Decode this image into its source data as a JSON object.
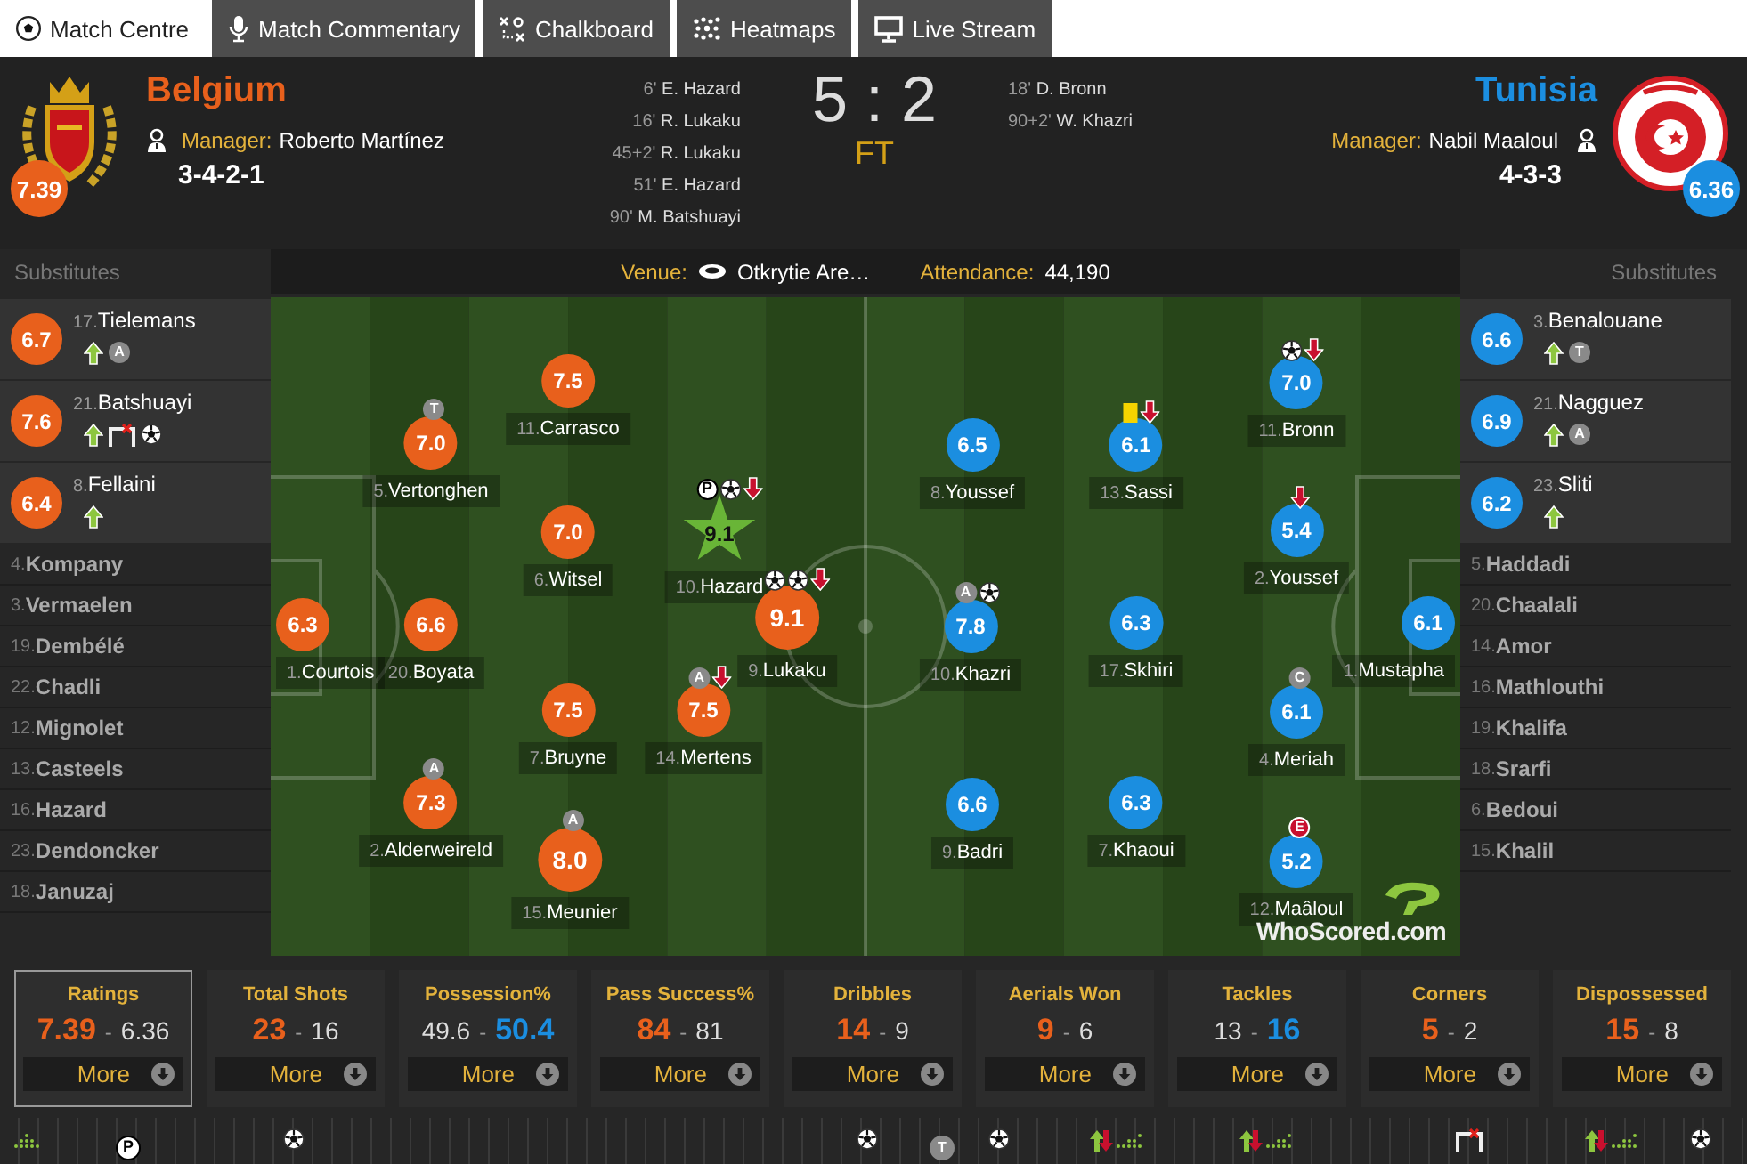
{
  "tabs": [
    {
      "label": "Match Centre",
      "selected": true
    },
    {
      "label": "Match Commentary",
      "selected": false
    },
    {
      "label": "Chalkboard",
      "selected": false
    },
    {
      "label": "Heatmaps",
      "selected": false
    },
    {
      "label": "Live Stream",
      "selected": false
    }
  ],
  "score": {
    "home": "5",
    "separator": ":",
    "away": "2",
    "status": "FT"
  },
  "home": {
    "name": "Belgium",
    "rating": "7.39",
    "manager_label": "Manager:",
    "manager": "Roberto Martínez",
    "formation": "3-4-2-1",
    "goals": [
      {
        "minute": "6'",
        "player": "E. Hazard"
      },
      {
        "minute": "16'",
        "player": "R. Lukaku"
      },
      {
        "minute": "45+2'",
        "player": "R. Lukaku"
      },
      {
        "minute": "51'",
        "player": "E. Hazard"
      },
      {
        "minute": "90'",
        "player": "M. Batshuayi"
      }
    ],
    "subs_title": "Substitutes",
    "subs_used": [
      {
        "number": "17.",
        "name": "Tielemans",
        "rating": "6.7",
        "incidents": [
          {
            "kind": "sub-on"
          },
          {
            "kind": "badge",
            "label": "A"
          }
        ]
      },
      {
        "number": "21.",
        "name": "Batshuayi",
        "rating": "7.6",
        "incidents": [
          {
            "kind": "sub-on"
          },
          {
            "kind": "miss"
          },
          {
            "kind": "goal"
          }
        ]
      },
      {
        "number": "8.",
        "name": "Fellaini",
        "rating": "6.4",
        "incidents": [
          {
            "kind": "sub-on"
          }
        ]
      }
    ],
    "subs_unused": [
      {
        "number": "4.",
        "name": "Kompany"
      },
      {
        "number": "3.",
        "name": "Vermaelen"
      },
      {
        "number": "19.",
        "name": "Dembélé"
      },
      {
        "number": "22.",
        "name": "Chadli"
      },
      {
        "number": "12.",
        "name": "Mignolet"
      },
      {
        "number": "13.",
        "name": "Casteels"
      },
      {
        "number": "16.",
        "name": "Hazard"
      },
      {
        "number": "23.",
        "name": "Dendoncker"
      },
      {
        "number": "18.",
        "name": "Januzaj"
      }
    ],
    "players": [
      {
        "number": "11.",
        "name": "Carrasco",
        "rating": "7.5",
        "motm": false
      },
      {
        "number": "5.",
        "name": "Vertonghen",
        "rating": "7.0",
        "motm": false,
        "incidents": [
          {
            "kind": "badge",
            "label": "T"
          }
        ]
      },
      {
        "number": "6.",
        "name": "Witsel",
        "rating": "7.0",
        "motm": false
      },
      {
        "number": "10.",
        "name": "Hazard",
        "rating": "9.1",
        "motm": true,
        "incidents": [
          {
            "kind": "penalty-badge",
            "label": "P"
          },
          {
            "kind": "goal"
          },
          {
            "kind": "sub-off"
          }
        ]
      },
      {
        "number": "1.",
        "name": "Courtois",
        "rating": "6.3",
        "motm": false
      },
      {
        "number": "20.",
        "name": "Boyata",
        "rating": "6.6",
        "motm": false
      },
      {
        "number": "9.",
        "name": "Lukaku",
        "rating": "9.1",
        "motm": false,
        "incidents": [
          {
            "kind": "goal"
          },
          {
            "kind": "goal"
          },
          {
            "kind": "sub-off"
          }
        ]
      },
      {
        "number": "7.",
        "name": "Bruyne",
        "rating": "7.5",
        "motm": false
      },
      {
        "number": "14.",
        "name": "Mertens",
        "rating": "7.5",
        "motm": false,
        "incidents": [
          {
            "kind": "badge",
            "label": "A"
          },
          {
            "kind": "sub-off"
          }
        ]
      },
      {
        "number": "2.",
        "name": "Alderweireld",
        "rating": "7.3",
        "motm": false,
        "incidents": [
          {
            "kind": "badge",
            "label": "A"
          }
        ]
      },
      {
        "number": "15.",
        "name": "Meunier",
        "rating": "8.0",
        "motm": false,
        "incidents": [
          {
            "kind": "badge",
            "label": "A"
          }
        ]
      }
    ]
  },
  "away": {
    "name": "Tunisia",
    "rating": "6.36",
    "manager_label": "Manager:",
    "manager": "Nabil Maaloul",
    "formation": "4-3-3",
    "goals": [
      {
        "minute": "18'",
        "player": "D. Bronn"
      },
      {
        "minute": "90+2'",
        "player": "W. Khazri"
      }
    ],
    "subs_title": "Substitutes",
    "subs_used": [
      {
        "number": "3.",
        "name": "Benalouane",
        "rating": "6.6",
        "incidents": [
          {
            "kind": "sub-on"
          },
          {
            "kind": "badge",
            "label": "T"
          }
        ]
      },
      {
        "number": "21.",
        "name": "Nagguez",
        "rating": "6.9",
        "incidents": [
          {
            "kind": "sub-on"
          },
          {
            "kind": "badge",
            "label": "A"
          }
        ]
      },
      {
        "number": "23.",
        "name": "Sliti",
        "rating": "6.2",
        "incidents": [
          {
            "kind": "sub-on"
          }
        ]
      }
    ],
    "subs_unused": [
      {
        "number": "5.",
        "name": "Haddadi"
      },
      {
        "number": "20.",
        "name": "Chaalali"
      },
      {
        "number": "14.",
        "name": "Amor"
      },
      {
        "number": "16.",
        "name": "Mathlouthi"
      },
      {
        "number": "19.",
        "name": "Khalifa"
      },
      {
        "number": "18.",
        "name": "Srarfi"
      },
      {
        "number": "6.",
        "name": "Bedoui"
      },
      {
        "number": "15.",
        "name": "Khalil"
      }
    ],
    "players": [
      {
        "number": "11.",
        "name": "Bronn",
        "rating": "7.0",
        "motm": false,
        "incidents": [
          {
            "kind": "goal"
          },
          {
            "kind": "sub-off"
          }
        ]
      },
      {
        "number": "8.",
        "name": "Youssef",
        "rating": "6.5",
        "motm": false
      },
      {
        "number": "13.",
        "name": "Sassi",
        "rating": "6.1",
        "motm": false,
        "incidents": [
          {
            "kind": "yellow-card"
          },
          {
            "kind": "sub-off"
          }
        ]
      },
      {
        "number": "2.",
        "name": "Youssef",
        "rating": "5.4",
        "motm": false,
        "incidents": [
          {
            "kind": "sub-off"
          }
        ]
      },
      {
        "number": "10.",
        "name": "Khazri",
        "rating": "7.8",
        "motm": false,
        "incidents": [
          {
            "kind": "badge",
            "label": "A"
          },
          {
            "kind": "goal"
          }
        ]
      },
      {
        "number": "17.",
        "name": "Skhiri",
        "rating": "6.3",
        "motm": false
      },
      {
        "number": "1.",
        "name": "Mustapha",
        "rating": "6.1",
        "motm": false
      },
      {
        "number": "4.",
        "name": "Meriah",
        "rating": "6.1",
        "motm": false,
        "incidents": [
          {
            "kind": "badge",
            "label": "C"
          }
        ]
      },
      {
        "number": "9.",
        "name": "Badri",
        "rating": "6.6",
        "motm": false
      },
      {
        "number": "7.",
        "name": "Khaoui",
        "rating": "6.3",
        "motm": false
      },
      {
        "number": "12.",
        "name": "Maâloul",
        "rating": "5.2",
        "motm": false,
        "incidents": [
          {
            "kind": "red-badge",
            "label": "E"
          }
        ]
      }
    ]
  },
  "venue": {
    "label": "Venue:",
    "value": "Otkrytie Are…",
    "attendance_label": "Attendance:",
    "attendance": "44,190"
  },
  "pitch_logo": "WhoScored.com",
  "stats": [
    {
      "title": "Ratings",
      "home": "7.39",
      "separator": "-",
      "away": "6.36",
      "home_highlighted": true,
      "away_highlighted": false,
      "button": "More",
      "selected": true
    },
    {
      "title": "Total Shots",
      "home": "23",
      "separator": "-",
      "away": "16",
      "home_highlighted": true,
      "away_highlighted": false,
      "button": "More",
      "selected": false
    },
    {
      "title": "Possession%",
      "home": "49.6",
      "separator": "-",
      "away": "50.4",
      "home_highlighted": false,
      "away_highlighted": true,
      "button": "More",
      "selected": false
    },
    {
      "title": "Pass Success%",
      "home": "84",
      "separator": "-",
      "away": "81",
      "home_highlighted": true,
      "away_highlighted": false,
      "button": "More",
      "selected": false
    },
    {
      "title": "Dribbles",
      "home": "14",
      "separator": "-",
      "away": "9",
      "home_highlighted": true,
      "away_highlighted": false,
      "button": "More",
      "selected": false
    },
    {
      "title": "Aerials Won",
      "home": "9",
      "separator": "-",
      "away": "6",
      "home_highlighted": true,
      "away_highlighted": false,
      "button": "More",
      "selected": false
    },
    {
      "title": "Tackles",
      "home": "13",
      "separator": "-",
      "away": "16",
      "home_highlighted": false,
      "away_highlighted": true,
      "button": "More",
      "selected": false
    },
    {
      "title": "Corners",
      "home": "5",
      "separator": "-",
      "away": "2",
      "home_highlighted": true,
      "away_highlighted": false,
      "button": "More",
      "selected": false
    },
    {
      "title": "Dispossessed",
      "home": "15",
      "separator": "-",
      "away": "8",
      "home_highlighted": true,
      "away_highlighted": false,
      "button": "More",
      "selected": false
    }
  ],
  "timeline": [
    {
      "kind": "stats"
    },
    {
      "kind": "penalty-badge",
      "label": "P"
    },
    {
      "kind": "goal"
    },
    {
      "kind": "goal"
    },
    {
      "kind": "badge",
      "label": "T"
    },
    {
      "kind": "goal"
    },
    {
      "kind": "swap"
    },
    {
      "kind": "swap"
    },
    {
      "kind": "miss"
    },
    {
      "kind": "swap"
    },
    {
      "kind": "goal"
    }
  ]
}
